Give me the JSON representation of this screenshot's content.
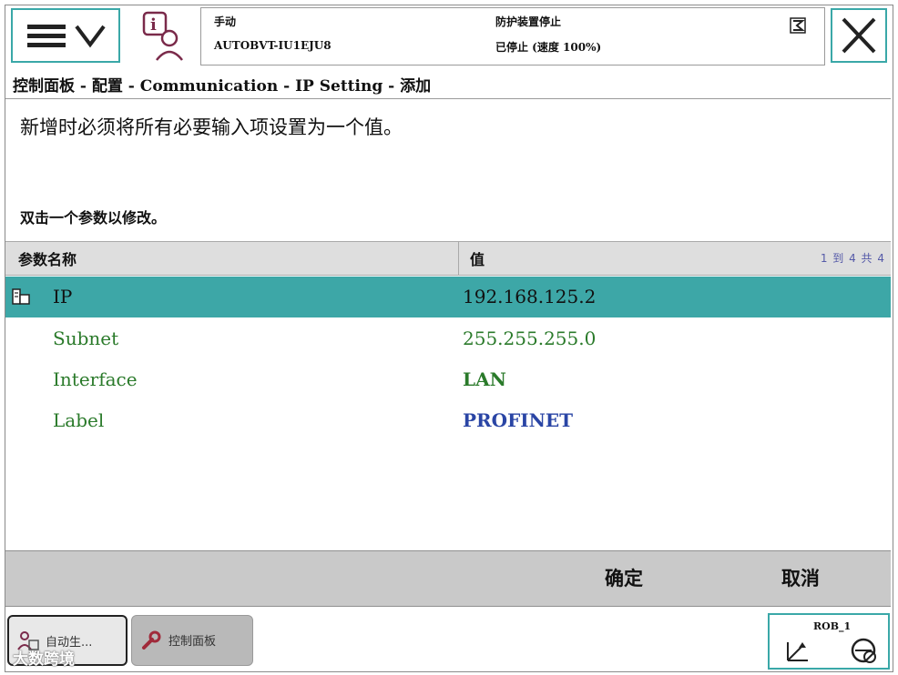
{
  "header": {
    "mode": "手动",
    "system_name": "AUTOBVT-IU1EJU8",
    "status_line1": "防护装置停止",
    "status_line2": "已停止 (速度 100%)"
  },
  "breadcrumb": "控制面板 - 配置 - Communication - IP Setting - 添加",
  "instruction": "新增时必须将所有必要输入项设置为一个值。",
  "hint": "双击一个参数以修改。",
  "table": {
    "col_name": "参数名称",
    "col_value": "值",
    "pager": "1 到 4 共 4",
    "rows": [
      {
        "name": "IP",
        "value": "192.168.125.2"
      },
      {
        "name": "Subnet",
        "value": "255.255.255.0"
      },
      {
        "name": "Interface",
        "value": "LAN"
      },
      {
        "name": "Label",
        "value": "PROFINET"
      }
    ]
  },
  "actions": {
    "ok": "确定",
    "cancel": "取消"
  },
  "taskbar": {
    "task1": "自动生...",
    "task2": "控制面板",
    "rob": "ROB_1"
  },
  "watermark": "大数跨境",
  "colors": {
    "accent": "#3da7a7",
    "value_green": "#2a7a2a",
    "value_blue": "#2a45a5"
  }
}
